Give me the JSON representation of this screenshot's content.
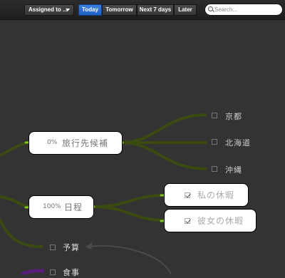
{
  "toolbar": {
    "filter_label": "Assigned to ...",
    "tabs": [
      {
        "label": "Today",
        "active": true
      },
      {
        "label": "Tomorrow",
        "active": false
      },
      {
        "label": "Next 7 days",
        "active": false
      },
      {
        "label": "Later",
        "active": false
      }
    ],
    "search_placeholder": "Search..."
  },
  "mindmap": {
    "nodes": [
      {
        "id": "travel",
        "percent": "0%",
        "label": "旅行先候補"
      },
      {
        "id": "schedule",
        "percent": "100%",
        "label": "日程"
      }
    ],
    "travel_children": [
      {
        "label": "京都",
        "checked": false
      },
      {
        "label": "北海道",
        "checked": false
      },
      {
        "label": "沖縄",
        "checked": false
      }
    ],
    "schedule_children": [
      {
        "label": "私の休暇",
        "checked": true
      },
      {
        "label": "彼女の休暇",
        "checked": true
      }
    ],
    "other_leaves": [
      {
        "label": "予算",
        "checked": false
      },
      {
        "label": "食事",
        "checked": false
      }
    ]
  },
  "colors": {
    "background": "#333333",
    "branch": "#3a4a10",
    "branch_active": "#7fc41a",
    "accent": "#1f5fc4"
  }
}
